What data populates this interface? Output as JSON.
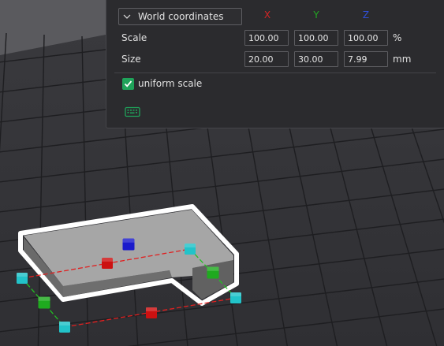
{
  "panel": {
    "coordinate_mode": "World coordinates",
    "axes": {
      "x": "X",
      "y": "Y",
      "z": "Z"
    },
    "scale": {
      "label": "Scale",
      "x": "100.00",
      "y": "100.00",
      "z": "100.00",
      "unit": "%"
    },
    "size": {
      "label": "Size",
      "x": "20.00",
      "y": "30.00",
      "z": "7.99",
      "unit": "mm"
    },
    "uniform_scale": {
      "label": "uniform scale",
      "checked": true
    },
    "keyboard_icon": "keyboard-icon"
  },
  "colors": {
    "axis_x": "#d42525",
    "axis_y": "#22a822",
    "axis_z": "#2f4fd8",
    "handle_x": "#cc1111",
    "handle_y": "#1faa1f",
    "handle_z": "#1a1acc",
    "handle_corner": "#22c3c9",
    "accent": "#1fa35a"
  }
}
